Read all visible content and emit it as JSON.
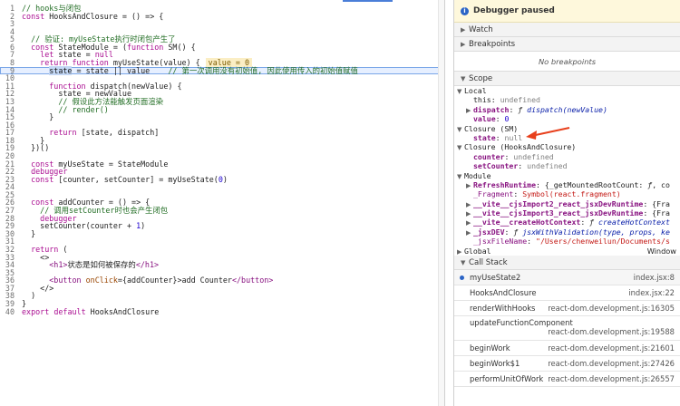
{
  "editor": {
    "lines": [
      {
        "n": "1",
        "parts": [
          [
            "c",
            "// hooks与闭包"
          ]
        ]
      },
      {
        "n": "2",
        "parts": [
          [
            "k",
            "const"
          ],
          [
            "",
            " HooksAndClosure = () => {"
          ]
        ]
      },
      {
        "n": "3",
        "parts": []
      },
      {
        "n": "4",
        "parts": []
      },
      {
        "n": "5",
        "parts": [
          [
            "",
            "  "
          ],
          [
            "c",
            "// 验证: myUseState执行时闭包产生了"
          ]
        ]
      },
      {
        "n": "6",
        "parts": [
          [
            "",
            "  "
          ],
          [
            "k",
            "const"
          ],
          [
            "",
            " StateModule = ("
          ],
          [
            "k",
            "function"
          ],
          [
            "",
            " SM() {"
          ]
        ]
      },
      {
        "n": "7",
        "parts": [
          [
            "",
            "    "
          ],
          [
            "k",
            "let"
          ],
          [
            "",
            " state = "
          ],
          [
            "k",
            "null"
          ]
        ]
      },
      {
        "n": "8",
        "parts": [
          [
            "",
            "    "
          ],
          [
            "k",
            "return"
          ],
          [
            "",
            " "
          ],
          [
            "k",
            "function"
          ],
          [
            "",
            " myUseState(value) {"
          ],
          [
            "v",
            "value = 0"
          ]
        ]
      },
      {
        "n": "9",
        "parts": [
          [
            "",
            "      "
          ],
          [
            "sel",
            "state"
          ],
          [
            "",
            " = state || value    "
          ],
          [
            "c",
            "// 第一次调用没有初始值, 因此使用传入的初始值赋值"
          ]
        ],
        "hl": true
      },
      {
        "n": "10",
        "parts": []
      },
      {
        "n": "11",
        "parts": [
          [
            "",
            "      "
          ],
          [
            "k",
            "function"
          ],
          [
            "",
            " dispatch(newValue) {"
          ]
        ]
      },
      {
        "n": "12",
        "parts": [
          [
            "",
            "        state = newValue"
          ]
        ]
      },
      {
        "n": "13",
        "parts": [
          [
            "",
            "        "
          ],
          [
            "c",
            "// 假设此方法能触发页面渲染"
          ]
        ]
      },
      {
        "n": "14",
        "parts": [
          [
            "",
            "        "
          ],
          [
            "c",
            "// render()"
          ]
        ]
      },
      {
        "n": "15",
        "parts": [
          [
            "",
            "      }"
          ]
        ]
      },
      {
        "n": "16",
        "parts": []
      },
      {
        "n": "17",
        "parts": [
          [
            "",
            "      "
          ],
          [
            "k",
            "return"
          ],
          [
            "",
            " [state, dispatch]"
          ]
        ]
      },
      {
        "n": "18",
        "parts": [
          [
            "",
            "    }"
          ]
        ]
      },
      {
        "n": "19",
        "parts": [
          [
            "",
            "  })()"
          ]
        ]
      },
      {
        "n": "20",
        "parts": []
      },
      {
        "n": "21",
        "parts": [
          [
            "",
            "  "
          ],
          [
            "k",
            "const"
          ],
          [
            "",
            " myUseState = StateModule"
          ]
        ]
      },
      {
        "n": "22",
        "parts": [
          [
            "",
            "  "
          ],
          [
            "k",
            "debugger"
          ]
        ]
      },
      {
        "n": "23",
        "parts": [
          [
            "",
            "  "
          ],
          [
            "k",
            "const"
          ],
          [
            "",
            " [counter, setCounter] = myUseState("
          ],
          [
            "n",
            "0"
          ],
          [
            "",
            ")"
          ]
        ]
      },
      {
        "n": "24",
        "parts": []
      },
      {
        "n": "25",
        "parts": []
      },
      {
        "n": "26",
        "parts": [
          [
            "",
            "  "
          ],
          [
            "k",
            "const"
          ],
          [
            "",
            " addCounter = () => {"
          ]
        ]
      },
      {
        "n": "27",
        "parts": [
          [
            "",
            "    "
          ],
          [
            "c",
            "// 调用setCounter时也会产生闭包"
          ]
        ]
      },
      {
        "n": "28",
        "parts": [
          [
            "",
            "    "
          ],
          [
            "k",
            "debugger"
          ]
        ]
      },
      {
        "n": "29",
        "parts": [
          [
            "",
            "    setCounter(counter + "
          ],
          [
            "n",
            "1"
          ],
          [
            "",
            ")"
          ]
        ]
      },
      {
        "n": "30",
        "parts": [
          [
            "",
            "  }"
          ]
        ]
      },
      {
        "n": "31",
        "parts": []
      },
      {
        "n": "32",
        "parts": [
          [
            "",
            "  "
          ],
          [
            "k",
            "return"
          ],
          [
            "",
            " ("
          ]
        ]
      },
      {
        "n": "33",
        "parts": [
          [
            "",
            "    <>"
          ]
        ]
      },
      {
        "n": "34",
        "parts": [
          [
            "",
            "      "
          ],
          [
            "tag",
            "<h1>"
          ],
          [
            "",
            "状态是如何被保存的"
          ],
          [
            "tag",
            "</h1>"
          ]
        ]
      },
      {
        "n": "35",
        "parts": []
      },
      {
        "n": "36",
        "parts": [
          [
            "",
            "      "
          ],
          [
            "tag",
            "<button "
          ],
          [
            "attr",
            "onClick"
          ],
          [
            "",
            "={addCounter}>add Counter"
          ],
          [
            "tag",
            "</button>"
          ]
        ]
      },
      {
        "n": "37",
        "parts": [
          [
            "",
            "    </>"
          ]
        ]
      },
      {
        "n": "38",
        "parts": [
          [
            "",
            "  )"
          ]
        ]
      },
      {
        "n": "39",
        "parts": [
          [
            "",
            "}"
          ]
        ]
      },
      {
        "n": "40",
        "parts": [
          [
            "k",
            "export"
          ],
          [
            "",
            " "
          ],
          [
            "k",
            "default"
          ],
          [
            "",
            " HooksAndClosure"
          ]
        ]
      }
    ]
  },
  "sidebar": {
    "paused_label": "Debugger paused",
    "watch_label": "Watch",
    "breakpoints_label": "Breakpoints",
    "no_breakpoints": "No breakpoints",
    "scope_label": "Scope",
    "scope_rows": [
      {
        "indent": 0,
        "tri": "▼",
        "parts": [
          [
            "t",
            "Local"
          ]
        ]
      },
      {
        "indent": 1,
        "tri": "",
        "parts": [
          [
            "t",
            "this: "
          ],
          [
            "null",
            "undefined"
          ]
        ]
      },
      {
        "indent": 1,
        "tri": "▶",
        "parts": [
          [
            "kb",
            "dispatch"
          ],
          [
            "t",
            ": "
          ],
          [
            "fk",
            "ƒ "
          ],
          [
            "fn",
            "dispatch(newValue)"
          ]
        ]
      },
      {
        "indent": 1,
        "tri": "",
        "parts": [
          [
            "kb",
            "value"
          ],
          [
            "t",
            ": "
          ],
          [
            "num",
            "0"
          ]
        ]
      },
      {
        "indent": 0,
        "tri": "▼",
        "parts": [
          [
            "t",
            "Closure (SM)"
          ]
        ]
      },
      {
        "indent": 1,
        "tri": "",
        "parts": [
          [
            "kb",
            "state"
          ],
          [
            "t",
            ": "
          ],
          [
            "null",
            "null"
          ]
        ]
      },
      {
        "indent": 0,
        "tri": "▼",
        "parts": [
          [
            "t",
            "Closure (HooksAndClosure)"
          ]
        ]
      },
      {
        "indent": 1,
        "tri": "",
        "parts": [
          [
            "kb",
            "counter"
          ],
          [
            "t",
            ": "
          ],
          [
            "null",
            "undefined"
          ]
        ]
      },
      {
        "indent": 1,
        "tri": "",
        "parts": [
          [
            "kb",
            "setCounter"
          ],
          [
            "t",
            ": "
          ],
          [
            "null",
            "undefined"
          ]
        ]
      },
      {
        "indent": 0,
        "tri": "▼",
        "parts": [
          [
            "t",
            "Module"
          ]
        ]
      },
      {
        "indent": 1,
        "tri": "▶",
        "parts": [
          [
            "kb",
            "RefreshRuntime"
          ],
          [
            "t",
            ": {_getMountedRootCount: "
          ],
          [
            "fk",
            "ƒ"
          ],
          [
            "t",
            ", co"
          ]
        ]
      },
      {
        "indent": 1,
        "tri": "",
        "parts": [
          [
            "k",
            "_Fragment"
          ],
          [
            "t",
            ": "
          ],
          [
            "str",
            "Symbol(react.fragment)"
          ]
        ]
      },
      {
        "indent": 1,
        "tri": "▶",
        "parts": [
          [
            "kb",
            "__vite__cjsImport2_react_jsxDevRuntime"
          ],
          [
            "t",
            ": {Fra"
          ]
        ]
      },
      {
        "indent": 1,
        "tri": "▶",
        "parts": [
          [
            "kb",
            "__vite__cjsImport3_react_jsxDevRuntime"
          ],
          [
            "t",
            ": {Fra"
          ]
        ]
      },
      {
        "indent": 1,
        "tri": "▶",
        "parts": [
          [
            "kb",
            "__vite__createHotContext"
          ],
          [
            "t",
            ": "
          ],
          [
            "fk",
            "ƒ "
          ],
          [
            "fn",
            "createHotContext"
          ]
        ]
      },
      {
        "indent": 1,
        "tri": "▶",
        "parts": [
          [
            "kb",
            "_jsxDEV"
          ],
          [
            "t",
            ": "
          ],
          [
            "fk",
            "ƒ "
          ],
          [
            "fn",
            "jsxWithValidation(type, props, ke"
          ]
        ]
      },
      {
        "indent": 1,
        "tri": "",
        "parts": [
          [
            "k",
            "_jsxFileName"
          ],
          [
            "t",
            ": "
          ],
          [
            "str",
            "\"/Users/chenweilun/Documents/s"
          ]
        ]
      },
      {
        "indent": 0,
        "tri": "▶",
        "parts": [
          [
            "t",
            "Global"
          ]
        ],
        "right": "Window"
      }
    ],
    "callstack_label": "Call Stack",
    "frames": [
      {
        "fn": "myUseState2",
        "loc": "index.jsx:8",
        "current": true
      },
      {
        "fn": "HooksAndClosure",
        "loc": "index.jsx:22"
      },
      {
        "fn": "renderWithHooks",
        "loc": "react-dom.development.js:16305"
      },
      {
        "fn": "updateFunctionComponent",
        "loc": "react-dom.development.js:19588",
        "two": true
      },
      {
        "fn": "beginWork",
        "loc": "react-dom.development.js:21601"
      },
      {
        "fn": "beginWork$1",
        "loc": "react-dom.development.js:27426"
      },
      {
        "fn": "performUnitOfWork",
        "loc": "react-dom.development.js:26557"
      }
    ]
  },
  "colors": {
    "accent": "#2b64c6",
    "paused_bg": "#fef8dc",
    "arrow": "#e8401c"
  }
}
